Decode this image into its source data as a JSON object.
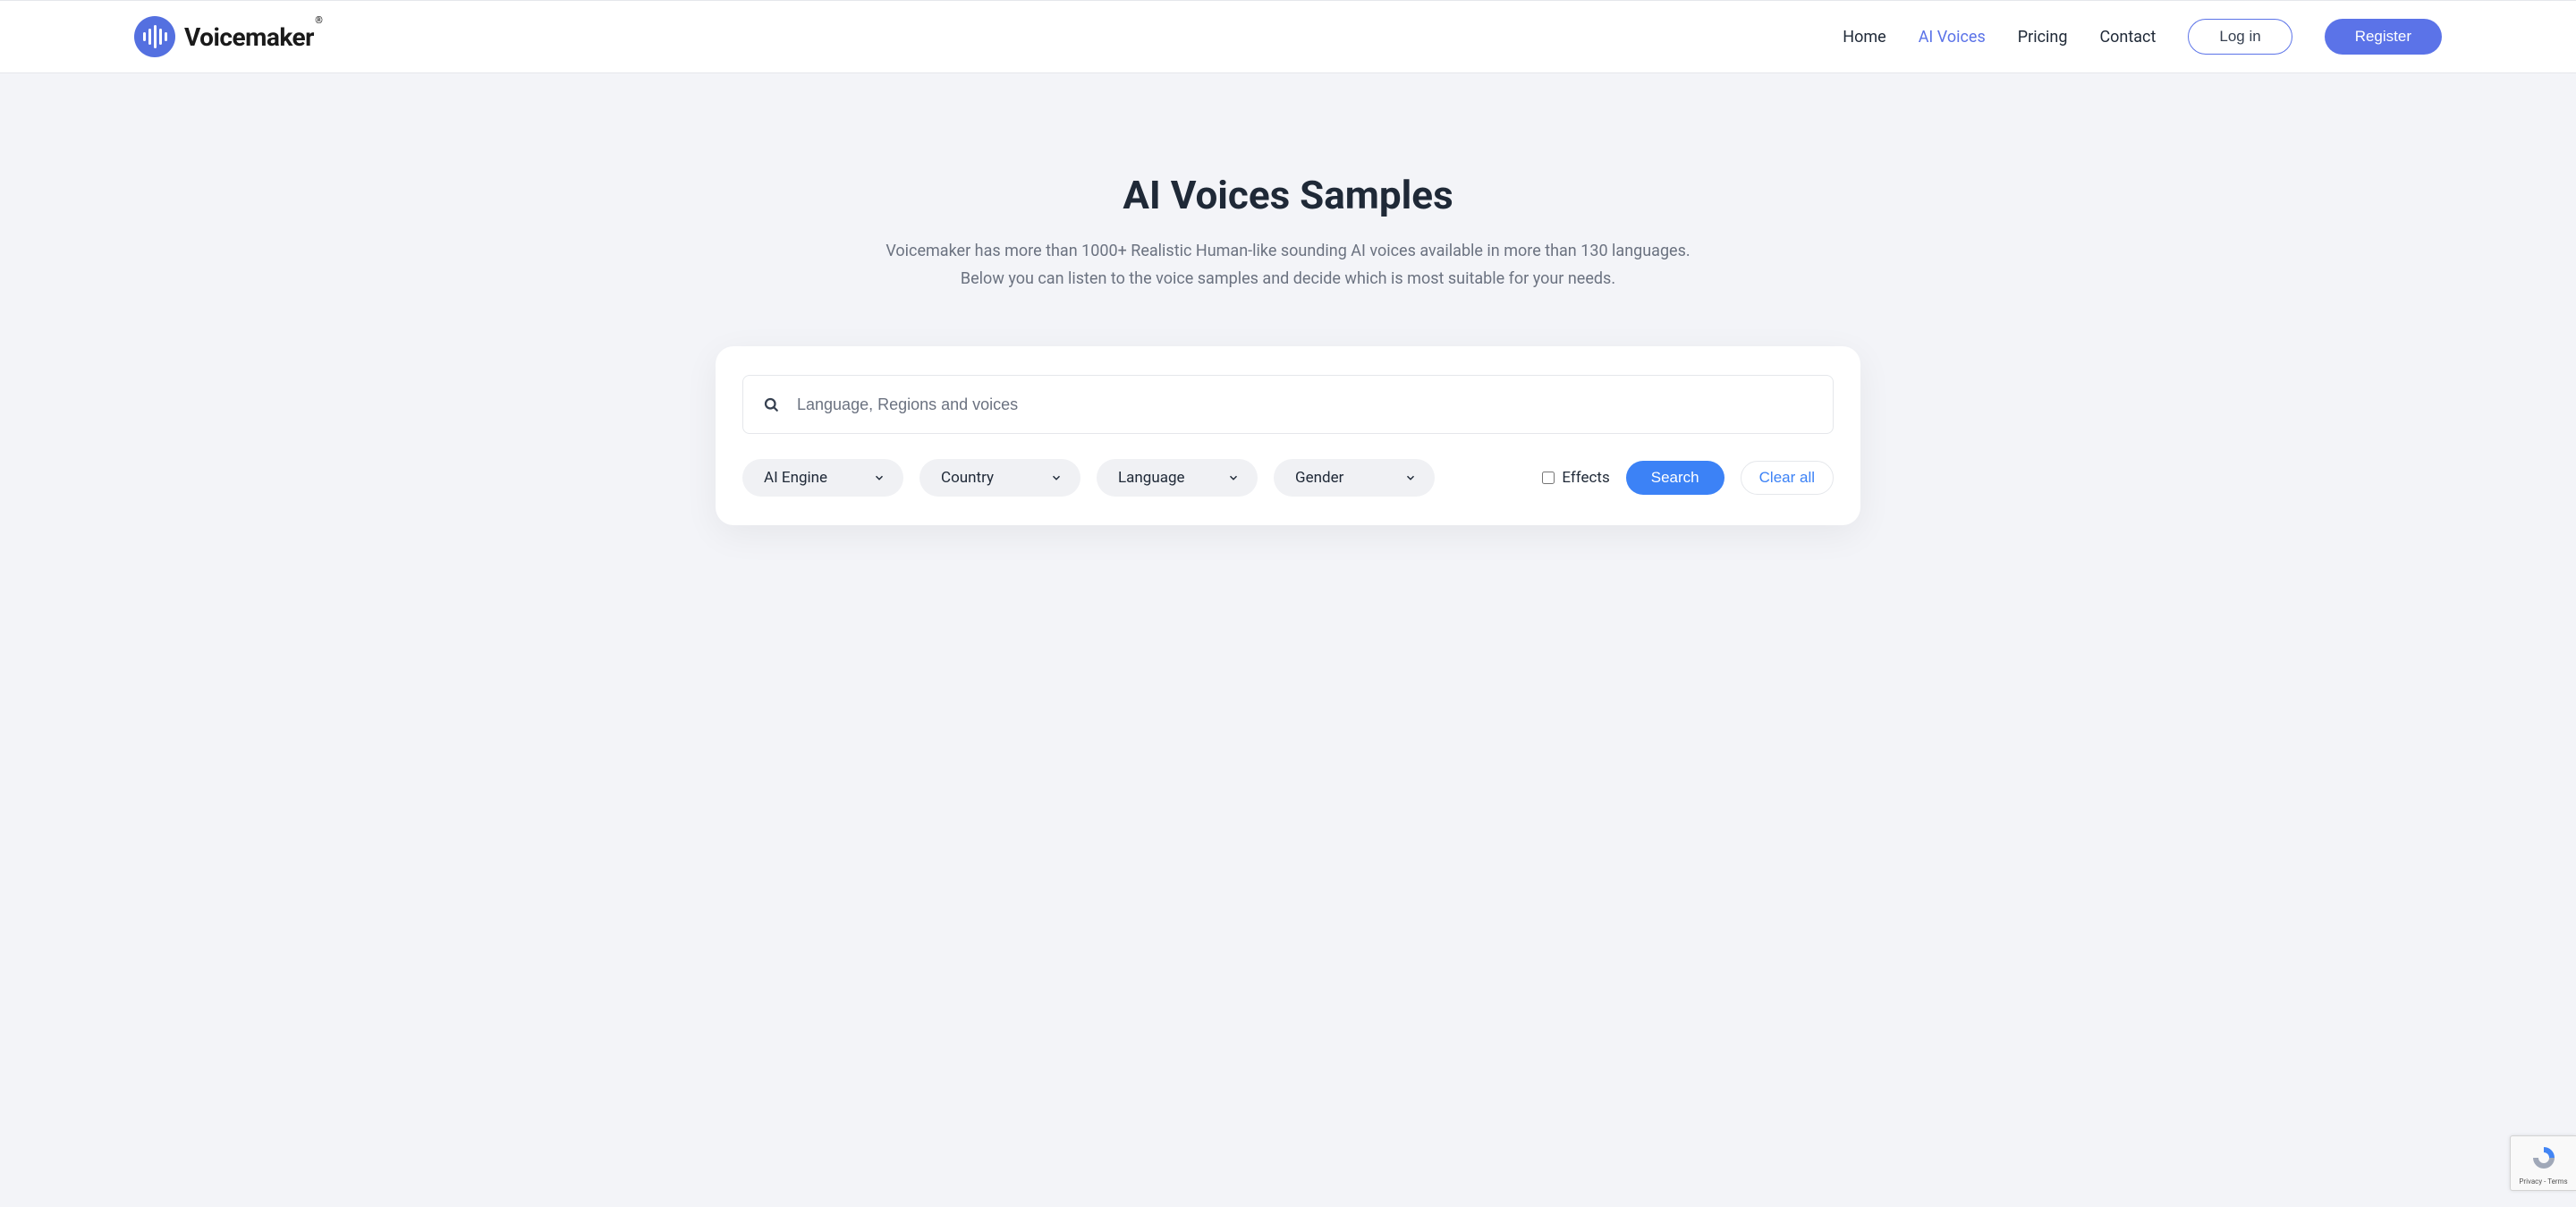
{
  "brand": {
    "name": "Voicemaker",
    "reg": "®"
  },
  "nav": {
    "home": "Home",
    "ai_voices": "AI Voices",
    "pricing": "Pricing",
    "contact": "Contact",
    "login": "Log in",
    "register": "Register"
  },
  "hero": {
    "title": "AI Voices Samples",
    "line1": "Voicemaker has more than 1000+ Realistic Human-like sounding AI voices available in more than 130 languages.",
    "line2": "Below you can listen to the voice samples and decide which is most suitable for your needs."
  },
  "search": {
    "placeholder": "Language, Regions and voices"
  },
  "filters": {
    "ai_engine": "AI Engine",
    "country": "Country",
    "language": "Language",
    "gender": "Gender",
    "effects": "Effects",
    "search_btn": "Search",
    "clear_btn": "Clear all"
  },
  "recaptcha": {
    "privacy": "Privacy",
    "dash": " - ",
    "terms": "Terms"
  }
}
